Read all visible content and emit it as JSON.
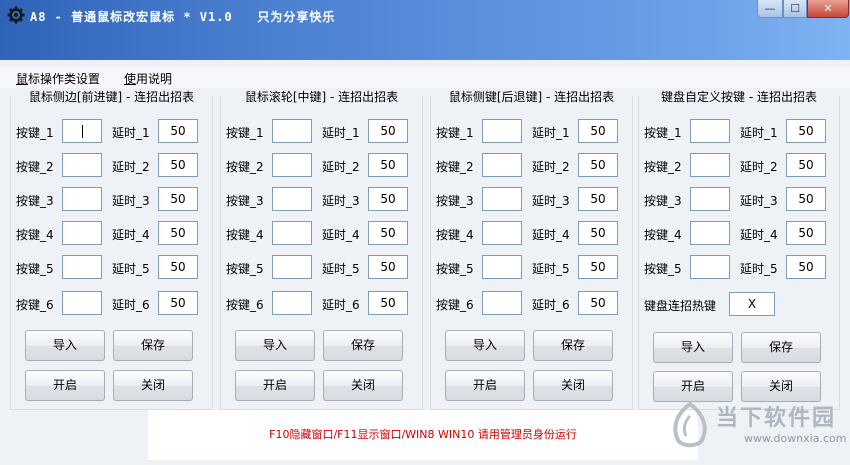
{
  "window": {
    "title": "A8 - 普通鼠标改宏鼠标 * V1.0   只为分享快乐",
    "buttons": {
      "minimize": "—",
      "maximize": "☐",
      "close": "✕"
    }
  },
  "menu": [
    {
      "label": "鼠标操作类设置",
      "underline_char": "鼠"
    },
    {
      "label": "使用说明",
      "underline_char": "使"
    }
  ],
  "panels": [
    {
      "title": "鼠标侧边[前进键] - 连招出招表",
      "rows": [
        {
          "key_label": "按键_1",
          "key_value": "",
          "delay_label": "延时_1",
          "delay_value": "50"
        },
        {
          "key_label": "按键_2",
          "key_value": "",
          "delay_label": "延时_2",
          "delay_value": "50"
        },
        {
          "key_label": "按键_3",
          "key_value": "",
          "delay_label": "延时_3",
          "delay_value": "50"
        },
        {
          "key_label": "按键_4",
          "key_value": "",
          "delay_label": "延时_4",
          "delay_value": "50"
        },
        {
          "key_label": "按键_5",
          "key_value": "",
          "delay_label": "延时_5",
          "delay_value": "50"
        },
        {
          "key_label": "按键_6",
          "key_value": "",
          "delay_label": "延时_6",
          "delay_value": "50"
        }
      ],
      "buttons": [
        "导入",
        "保存",
        "开启",
        "关闭"
      ]
    },
    {
      "title": "鼠标滚轮[中键] - 连招出招表",
      "rows": [
        {
          "key_label": "按键_1",
          "key_value": "",
          "delay_label": "延时_1",
          "delay_value": "50"
        },
        {
          "key_label": "按键_2",
          "key_value": "",
          "delay_label": "延时_2",
          "delay_value": "50"
        },
        {
          "key_label": "按键_3",
          "key_value": "",
          "delay_label": "延时_3",
          "delay_value": "50"
        },
        {
          "key_label": "按键_4",
          "key_value": "",
          "delay_label": "延时_4",
          "delay_value": "50"
        },
        {
          "key_label": "按键_5",
          "key_value": "",
          "delay_label": "延时_5",
          "delay_value": "50"
        },
        {
          "key_label": "按键_6",
          "key_value": "",
          "delay_label": "延时_6",
          "delay_value": "50"
        }
      ],
      "buttons": [
        "导入",
        "保存",
        "开启",
        "关闭"
      ]
    },
    {
      "title": "鼠标侧键[后退键] - 连招出招表",
      "rows": [
        {
          "key_label": "按键_1",
          "key_value": "",
          "delay_label": "延时_1",
          "delay_value": "50"
        },
        {
          "key_label": "按键_2",
          "key_value": "",
          "delay_label": "延时_2",
          "delay_value": "50"
        },
        {
          "key_label": "按键_3",
          "key_value": "",
          "delay_label": "延时_3",
          "delay_value": "50"
        },
        {
          "key_label": "按键_4",
          "key_value": "",
          "delay_label": "延时_4",
          "delay_value": "50"
        },
        {
          "key_label": "按键_5",
          "key_value": "",
          "delay_label": "延时_5",
          "delay_value": "50"
        },
        {
          "key_label": "按键_6",
          "key_value": "",
          "delay_label": "延时_6",
          "delay_value": "50"
        }
      ],
      "buttons": [
        "导入",
        "保存",
        "开启",
        "关闭"
      ]
    },
    {
      "title": "键盘自定义按键 - 连招出招表",
      "rows": [
        {
          "key_label": "按键_1",
          "key_value": "",
          "delay_label": "延时_1",
          "delay_value": "50"
        },
        {
          "key_label": "按键_2",
          "key_value": "",
          "delay_label": "延时_2",
          "delay_value": "50"
        },
        {
          "key_label": "按键_3",
          "key_value": "",
          "delay_label": "延时_3",
          "delay_value": "50"
        },
        {
          "key_label": "按键_4",
          "key_value": "",
          "delay_label": "延时_4",
          "delay_value": "50"
        },
        {
          "key_label": "按键_5",
          "key_value": "",
          "delay_label": "延时_5",
          "delay_value": "50"
        }
      ],
      "hotkey_label": "键盘连招热键",
      "hotkey_value": "X",
      "buttons": [
        "导入",
        "保存",
        "开启",
        "关闭"
      ]
    }
  ],
  "status": "F10隐藏窗口/F11显示窗口/WIN8 WIN10 请用管理员身份运行",
  "watermark": {
    "name": "当下软件园",
    "url": "www.downxia.com"
  },
  "colors": {
    "status_text": "#d00000",
    "title_gradient_start": "#2f63b8",
    "title_gradient_end": "#7fb3f2"
  }
}
